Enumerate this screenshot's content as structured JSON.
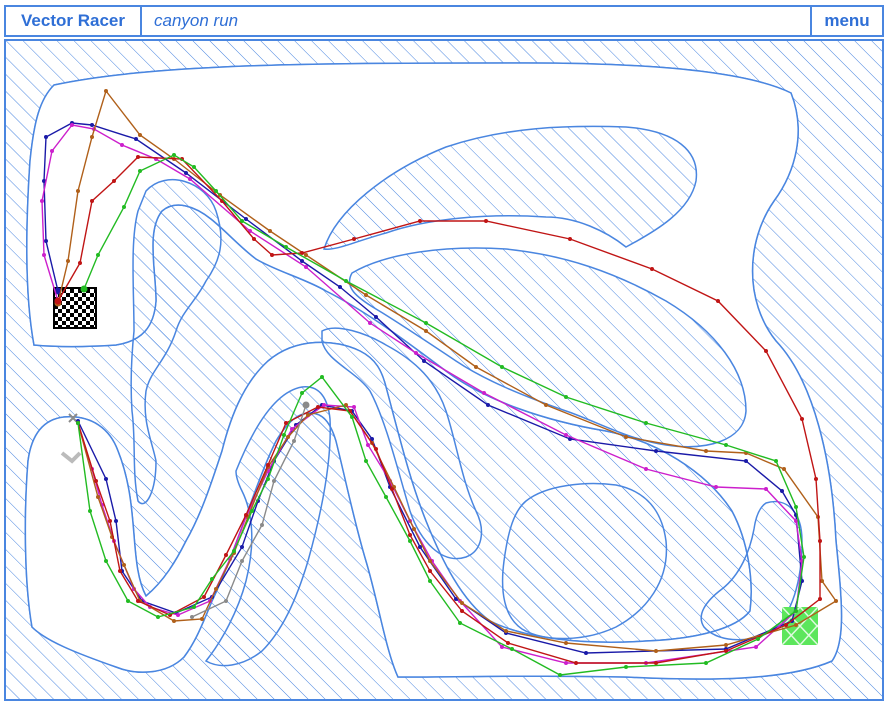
{
  "app": {
    "title": "Vector Racer",
    "track_name": "canyon run",
    "menu_label": "menu"
  },
  "colors": {
    "accent": "#4a86e0",
    "grid": "#b9cdf2",
    "wall_stroke": "#4a86e0",
    "hatch": "#4a86e0",
    "finish_start": "#000000",
    "goal_zone": "#5ce65c"
  },
  "icons": {
    "start_marker": "checkered-flag-icon",
    "goal_marker": "green-goal-zone-icon",
    "crash_marker": "x-mark-icon"
  },
  "racers": [
    {
      "id": "blue",
      "color": "#1a1aa8"
    },
    {
      "id": "magenta",
      "color": "#cc1fcc"
    },
    {
      "id": "brown",
      "color": "#b0601a"
    },
    {
      "id": "red",
      "color": "#c01515"
    },
    {
      "id": "green",
      "color": "#22bb22"
    },
    {
      "id": "gray",
      "color": "#8a8a8a"
    }
  ]
}
